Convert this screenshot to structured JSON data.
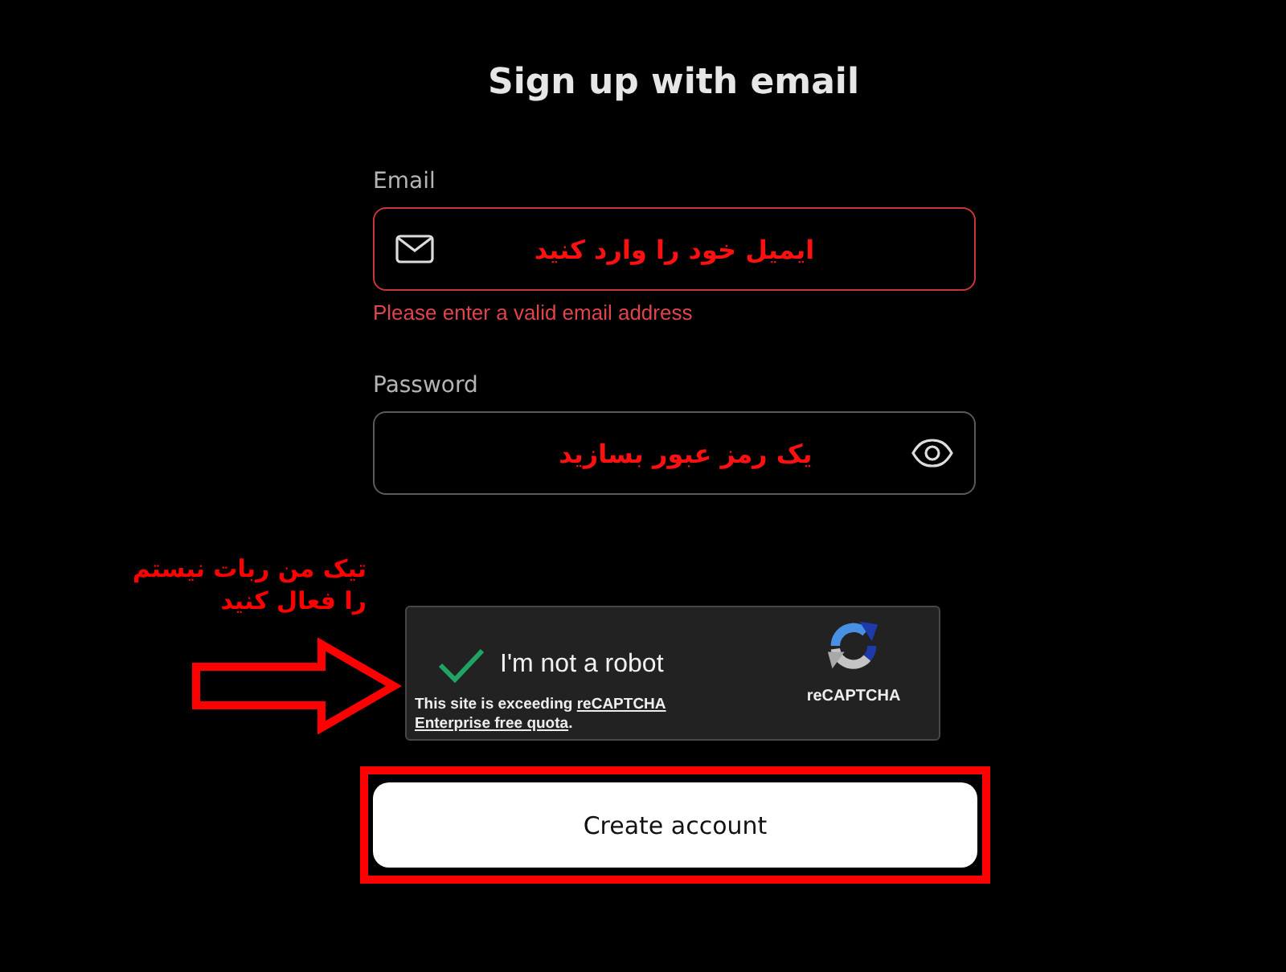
{
  "title": "Sign up with email",
  "fields": [
    {
      "kind": "email",
      "label": "Email",
      "invalid": true,
      "annotation": "ایمیل خود را وارد کنید",
      "error": "Please enter a valid email address"
    },
    {
      "kind": "password",
      "label": "Password",
      "invalid": false,
      "annotation": "یک رمز عبور بسازید"
    }
  ],
  "captcha": {
    "checked": true,
    "label": "I'm not a robot",
    "notice": [
      [
        {
          "kind": "text",
          "text": "This site is exceeding "
        },
        {
          "kind": "link",
          "text": "reCAPTCHA"
        }
      ],
      [
        {
          "kind": "link",
          "text": "Enterprise free quota"
        },
        {
          "kind": "text",
          "text": "."
        }
      ]
    ],
    "brand": "reCAPTCHA",
    "callout": {
      "lines": [
        "تیک من ربات نیستم",
        "را فعال کنید"
      ],
      "arrow": true
    }
  },
  "submit": {
    "label": "Create account",
    "highlighted": true
  }
}
